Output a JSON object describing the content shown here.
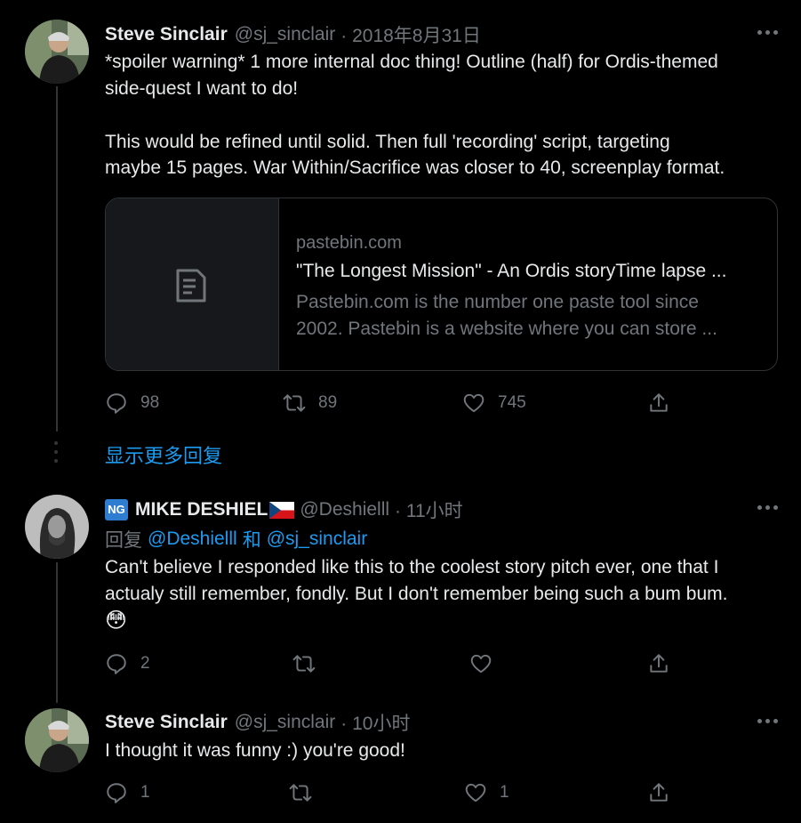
{
  "tweets": [
    {
      "name": "Steve Sinclair",
      "handle": "@sj_sinclair",
      "time": "· 2018年8月31日",
      "lines": [
        "*spoiler warning* 1 more internal doc thing! Outline (half) for Ordis-themed",
        "side-quest I want to do!",
        "This would be refined until solid. Then full 'recording' script, targeting",
        "maybe 15 pages. War Within/Sacrifice was closer to 40, screenplay format."
      ],
      "card": {
        "domain": "pastebin.com",
        "title": "\"The Longest Mission\" - An Ordis storyTime lapse ...",
        "desc_line1": "Pastebin.com is the number one paste tool since",
        "desc_line2": "2002. Pastebin is a website where you can store ..."
      },
      "replies": "98",
      "retweets": "89",
      "likes": "745"
    },
    {
      "name": "MIKE DESHIEL",
      "badge": "NG",
      "handle": "@Deshielll",
      "time": "· 11小时",
      "reply_prefix": "回复",
      "reply_to_1": "@Deshielll",
      "reply_and": "和",
      "reply_to_2": "@sj_sinclair",
      "line1": "Can't believe I responded like this to the coolest story pitch ever, one that I",
      "line2": "actualy still remember, fondly. But I don't remember being such a bum bum.",
      "emoji": "😳",
      "replies": "2"
    },
    {
      "name": "Steve Sinclair",
      "handle": "@sj_sinclair",
      "time": "· 10小时",
      "line1": "I thought it was funny :) you're good!",
      "replies": "1",
      "likes": "1"
    }
  ],
  "show_more": "显示更多回复",
  "colors": {
    "accent": "#1d9bf0",
    "muted": "#71767b",
    "background": "#000000"
  }
}
